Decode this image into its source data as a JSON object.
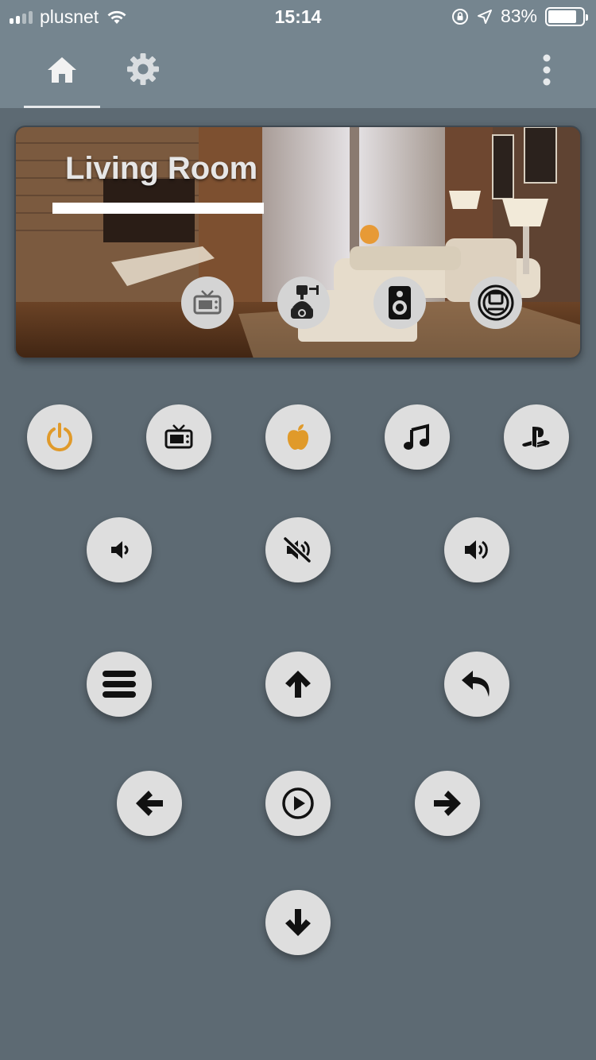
{
  "status_bar": {
    "carrier": "plusnet",
    "time": "15:14",
    "battery_text": "83%",
    "battery_level": 0.83,
    "signal_bars": 4,
    "signal_active": 2
  },
  "nav": {
    "tabs": [
      {
        "icon": "home-icon",
        "active": true
      },
      {
        "icon": "gear-icon",
        "active": false
      }
    ],
    "menu_icon": "more-vertical-icon"
  },
  "room": {
    "title": "Living Room",
    "devices": [
      {
        "icon": "tv-icon"
      },
      {
        "icon": "projector-icon"
      },
      {
        "icon": "speaker-icon"
      },
      {
        "icon": "robot-vacuum-icon"
      }
    ]
  },
  "remote": {
    "sources": [
      {
        "icon": "power-icon",
        "color": "#e09a2a"
      },
      {
        "icon": "tv-icon",
        "color": "#111111"
      },
      {
        "icon": "apple-icon",
        "color": "#e09a2a"
      },
      {
        "icon": "music-icon",
        "color": "#111111"
      },
      {
        "icon": "playstation-icon",
        "color": "#111111"
      }
    ],
    "volume": [
      "volume-down-icon",
      "mute-icon",
      "volume-up-icon"
    ],
    "navigation": [
      "menu-icon",
      "arrow-up-icon",
      "back-icon",
      "arrow-left-icon",
      "play-icon",
      "arrow-right-icon",
      "arrow-down-icon"
    ]
  },
  "colors": {
    "background": "#5d6a73",
    "header": "#75858f",
    "button": "#dedede",
    "accent": "#e09a2a"
  }
}
